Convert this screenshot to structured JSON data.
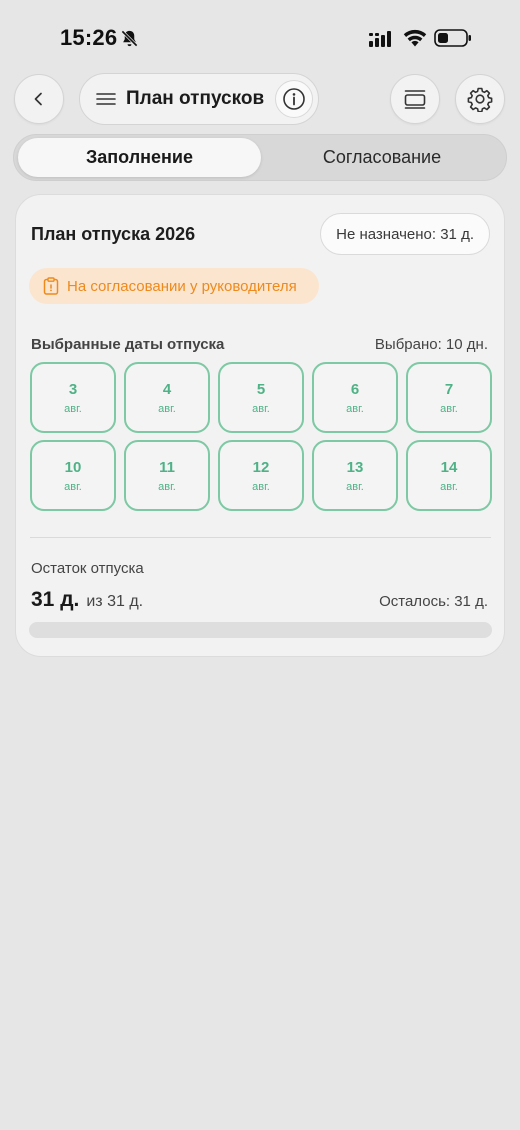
{
  "status_bar": {
    "time": "15:26",
    "icons": [
      "bell-slash-icon",
      "signal-icon",
      "wifi-icon",
      "battery-icon"
    ]
  },
  "header": {
    "back_icon": "chevron-left-icon",
    "menu_icon": "hamburger-icon",
    "title": "План отпусков",
    "info_icon": "info-icon",
    "layout_icon": "layout-icon",
    "settings_icon": "gear-icon"
  },
  "tabs": [
    {
      "label": "Заполнение",
      "active": true
    },
    {
      "label": "Согласование",
      "active": false
    }
  ],
  "plan": {
    "title": "План отпуска 2026",
    "unassigned": "Не назначено: 31 д.",
    "status": "На согласовании у руководителя",
    "status_color": "#ee8a1c",
    "dates_label": "Выбранные даты отпуска",
    "selected_count": "Выбрано: 10 дн.",
    "dates": [
      {
        "day": "3",
        "month": "авг."
      },
      {
        "day": "4",
        "month": "авг."
      },
      {
        "day": "5",
        "month": "авг."
      },
      {
        "day": "6",
        "month": "авг."
      },
      {
        "day": "7",
        "month": "авг."
      },
      {
        "day": "10",
        "month": "авг."
      },
      {
        "day": "11",
        "month": "авг."
      },
      {
        "day": "12",
        "month": "авг."
      },
      {
        "day": "13",
        "month": "авг."
      },
      {
        "day": "14",
        "month": "авг."
      }
    ],
    "accent_color": "#4fb287"
  },
  "remaining": {
    "label": "Остаток отпуска",
    "days": "31 д.",
    "total": "из 31 д.",
    "left": "Осталось: 31 д.",
    "used_fraction": 0
  }
}
